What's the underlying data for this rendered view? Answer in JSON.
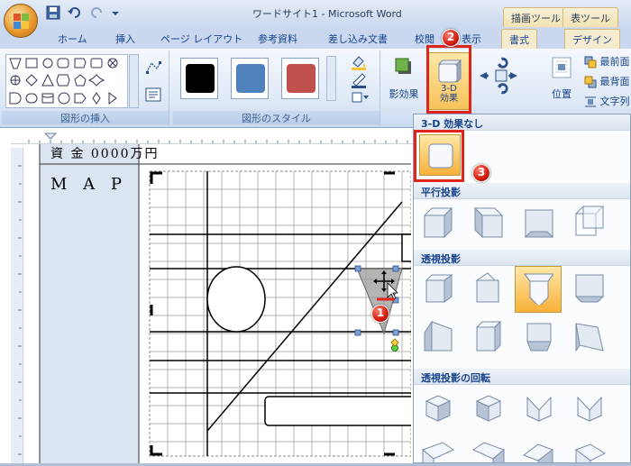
{
  "window": {
    "title": "ワードサイト1 - Microsoft Word"
  },
  "contextual_tabs": {
    "drawing_tools": "描画ツール",
    "table_tools": "表ツール"
  },
  "tabs": [
    "ホーム",
    "挿入",
    "ページ レイアウト",
    "参考資料",
    "差し込み文書",
    "校閲",
    "表示",
    "書式",
    "デザイン"
  ],
  "active_tab": "書式",
  "ribbon": {
    "groups": {
      "insert_shapes": "図形の挿入",
      "shape_styles": "図形のスタイル"
    },
    "shadow_effects": "影効果",
    "threed_effects_line1": "3-D",
    "threed_effects_line2": "効果",
    "position": "位置",
    "bring_front": "最前面",
    "send_back": "最背面",
    "text_wrap": "文字列",
    "style_colors": [
      "#000000",
      "#4f81bd",
      "#c0504d"
    ]
  },
  "dropdown": {
    "no_3d": "3-D 効果なし",
    "parallel": "平行投影",
    "perspective": "透視投影",
    "rotation": "透視投影の回転"
  },
  "document": {
    "row_label": "M A P",
    "header_partial": "資 金  0000万円"
  },
  "callouts": {
    "one": "1",
    "two": "2",
    "three": "3"
  }
}
